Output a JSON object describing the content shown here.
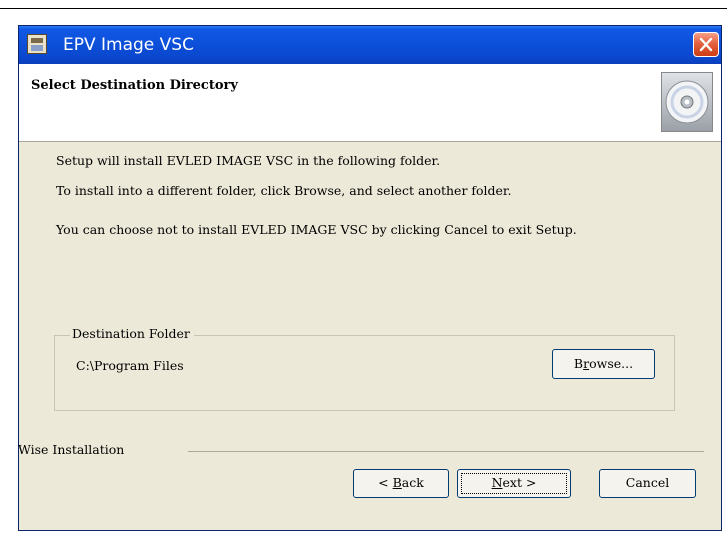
{
  "window": {
    "title": "EPV Image VSC"
  },
  "header": {
    "title": "Select Destination Directory"
  },
  "body": {
    "line1": "Setup will install EVLED IMAGE VSC in the following folder.",
    "line2": "To install into a different folder, click Browse, and select another folder.",
    "line3": "You can choose not to install EVLED IMAGE VSC by clicking Cancel to exit Setup."
  },
  "destination": {
    "legend": "Destination Folder",
    "path": "C:\\Program Files",
    "browse_prefix": "B",
    "browse_mnemonic": "r",
    "browse_suffix": "owse..."
  },
  "footer": {
    "brand": "Wise Installation",
    "back_prefix": "< ",
    "back_mnemonic": "B",
    "back_suffix": "ack",
    "next_mnemonic": "N",
    "next_suffix": "ext >",
    "cancel_label": "Cancel"
  },
  "icons": {
    "title": "setup-app-icon",
    "close": "close-icon",
    "header": "cd-disc-icon"
  }
}
